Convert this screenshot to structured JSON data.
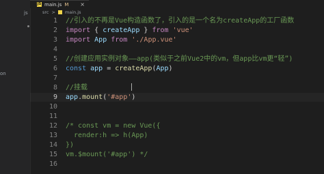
{
  "sidebar": {
    "fragments": [
      "js",
      "on"
    ]
  },
  "tab": {
    "filename": "main.js",
    "modified": "M",
    "close": "×",
    "icon": "js-icon"
  },
  "breadcrumb": {
    "folder": "src",
    "separator": ">",
    "file": "main.js"
  },
  "editor": {
    "active_line": 8,
    "lines": [
      {
        "n": "1",
        "tokens": [
          {
            "t": "//引入的不再是Vue构造函数了，引入的是一个名为createApp的工厂函数",
            "c": "cmt"
          }
        ]
      },
      {
        "n": "2",
        "tokens": [
          {
            "t": "import",
            "c": "kw"
          },
          {
            "t": " { ",
            "c": "pln"
          },
          {
            "t": "createApp",
            "c": "var"
          },
          {
            "t": " } ",
            "c": "pln"
          },
          {
            "t": "from",
            "c": "kw"
          },
          {
            "t": " ",
            "c": "pln"
          },
          {
            "t": "'vue'",
            "c": "str"
          }
        ]
      },
      {
        "n": "3",
        "tokens": [
          {
            "t": "import",
            "c": "kw"
          },
          {
            "t": " ",
            "c": "pln"
          },
          {
            "t": "App",
            "c": "var"
          },
          {
            "t": " ",
            "c": "pln"
          },
          {
            "t": "from",
            "c": "kw"
          },
          {
            "t": " ",
            "c": "pln"
          },
          {
            "t": "'./App.vue'",
            "c": "str"
          }
        ]
      },
      {
        "n": "4",
        "tokens": []
      },
      {
        "n": "5",
        "tokens": [
          {
            "t": "//创建应用实例对象——app(类似于之前Vue2中的vm，但app比vm更“轻”)",
            "c": "cmt"
          }
        ]
      },
      {
        "n": "6",
        "tokens": [
          {
            "t": "const",
            "c": "dk"
          },
          {
            "t": " ",
            "c": "pln"
          },
          {
            "t": "app",
            "c": "var"
          },
          {
            "t": " = ",
            "c": "pln"
          },
          {
            "t": "createApp",
            "c": "fn"
          },
          {
            "t": "(",
            "c": "pln"
          },
          {
            "t": "App",
            "c": "var"
          },
          {
            "t": ")",
            "c": "pln"
          }
        ]
      },
      {
        "n": "7",
        "tokens": []
      },
      {
        "n": "8",
        "tokens": [
          {
            "t": "//挂载",
            "c": "cmt"
          }
        ]
      },
      {
        "n": "9",
        "tokens": [
          {
            "t": "app",
            "c": "var"
          },
          {
            "t": ".",
            "c": "pln"
          },
          {
            "t": "mount",
            "c": "fn"
          },
          {
            "t": "(",
            "c": "pln"
          },
          {
            "t": "'#app'",
            "c": "str"
          },
          {
            "t": ")",
            "c": "pln"
          }
        ]
      },
      {
        "n": "10",
        "tokens": []
      },
      {
        "n": "11",
        "tokens": []
      },
      {
        "n": "12",
        "tokens": [
          {
            "t": "/* const vm = new Vue({",
            "c": "cmt"
          }
        ]
      },
      {
        "n": "13",
        "tokens": [
          {
            "t": "  render:h => h(App)",
            "c": "cmt"
          }
        ]
      },
      {
        "n": "14",
        "tokens": [
          {
            "t": "})",
            "c": "cmt"
          }
        ]
      },
      {
        "n": "15",
        "tokens": [
          {
            "t": "vm.$mount('#app') */",
            "c": "cmt"
          }
        ]
      },
      {
        "n": "16",
        "tokens": []
      }
    ]
  }
}
